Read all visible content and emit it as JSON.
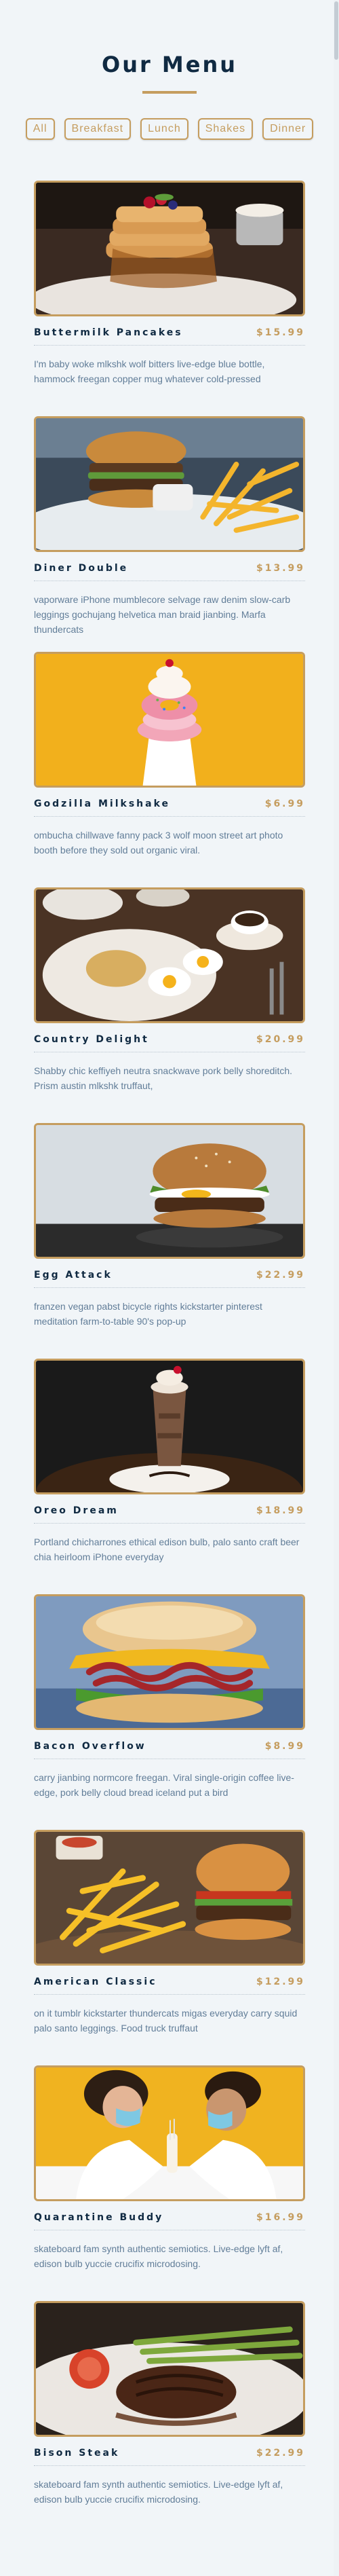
{
  "page": {
    "title": "Our Menu",
    "accent_color": "#c59d5f",
    "background_color": "#f1f5f8"
  },
  "filters": [
    "All",
    "Breakfast",
    "Lunch",
    "Shakes",
    "Dinner"
  ],
  "items": [
    {
      "name": "Buttermilk Pancakes",
      "price": "$15.99",
      "desc": "I'm baby woke mlkshk wolf bitters live-edge blue bottle, hammock freegan copper mug whatever cold-pressed",
      "image": "pancakes"
    },
    {
      "name": "Diner Double",
      "price": "$13.99",
      "desc": "vaporware iPhone mumblecore selvage raw denim slow-carb leggings gochujang helvetica man braid jianbing. Marfa thundercats",
      "image": "burger-fries"
    },
    {
      "name": "Godzilla Milkshake",
      "price": "$6.99",
      "desc": "ombucha chillwave fanny pack 3 wolf moon street art photo booth before they sold out organic viral.",
      "image": "milkshake-donut"
    },
    {
      "name": "Country Delight",
      "price": "$20.99",
      "desc": "Shabby chic keffiyeh neutra snackwave pork belly shoreditch. Prism austin mlkshk truffaut,",
      "image": "eggs-coffee"
    },
    {
      "name": "Egg Attack",
      "price": "$22.99",
      "desc": "franzen vegan pabst bicycle rights kickstarter pinterest meditation farm-to-table 90's pop-up",
      "image": "egg-burger"
    },
    {
      "name": "Oreo Dream",
      "price": "$18.99",
      "desc": "Portland chicharrones ethical edison bulb, palo santo craft beer chia heirloom iPhone everyday",
      "image": "oreo-shake"
    },
    {
      "name": "Bacon Overflow",
      "price": "$8.99",
      "desc": "carry jianbing normcore freegan. Viral single-origin coffee live-edge, pork belly cloud bread iceland put a bird",
      "image": "bacon-sandwich"
    },
    {
      "name": "American Classic",
      "price": "$12.99",
      "desc": "on it tumblr kickstarter thundercats migas everyday carry squid palo santo leggings. Food truck truffaut",
      "image": "classic-burger-fries"
    },
    {
      "name": "Quarantine Buddy",
      "price": "$16.99",
      "desc": "skateboard fam synth authentic semiotics. Live-edge lyft af, edison bulb yuccie crucifix microdosing.",
      "image": "masked-couple"
    },
    {
      "name": "Bison Steak",
      "price": "$22.99",
      "desc": "skateboard fam synth authentic semiotics. Live-edge lyft af, edison bulb yuccie crucifix microdosing.",
      "image": "steak-plate"
    }
  ]
}
